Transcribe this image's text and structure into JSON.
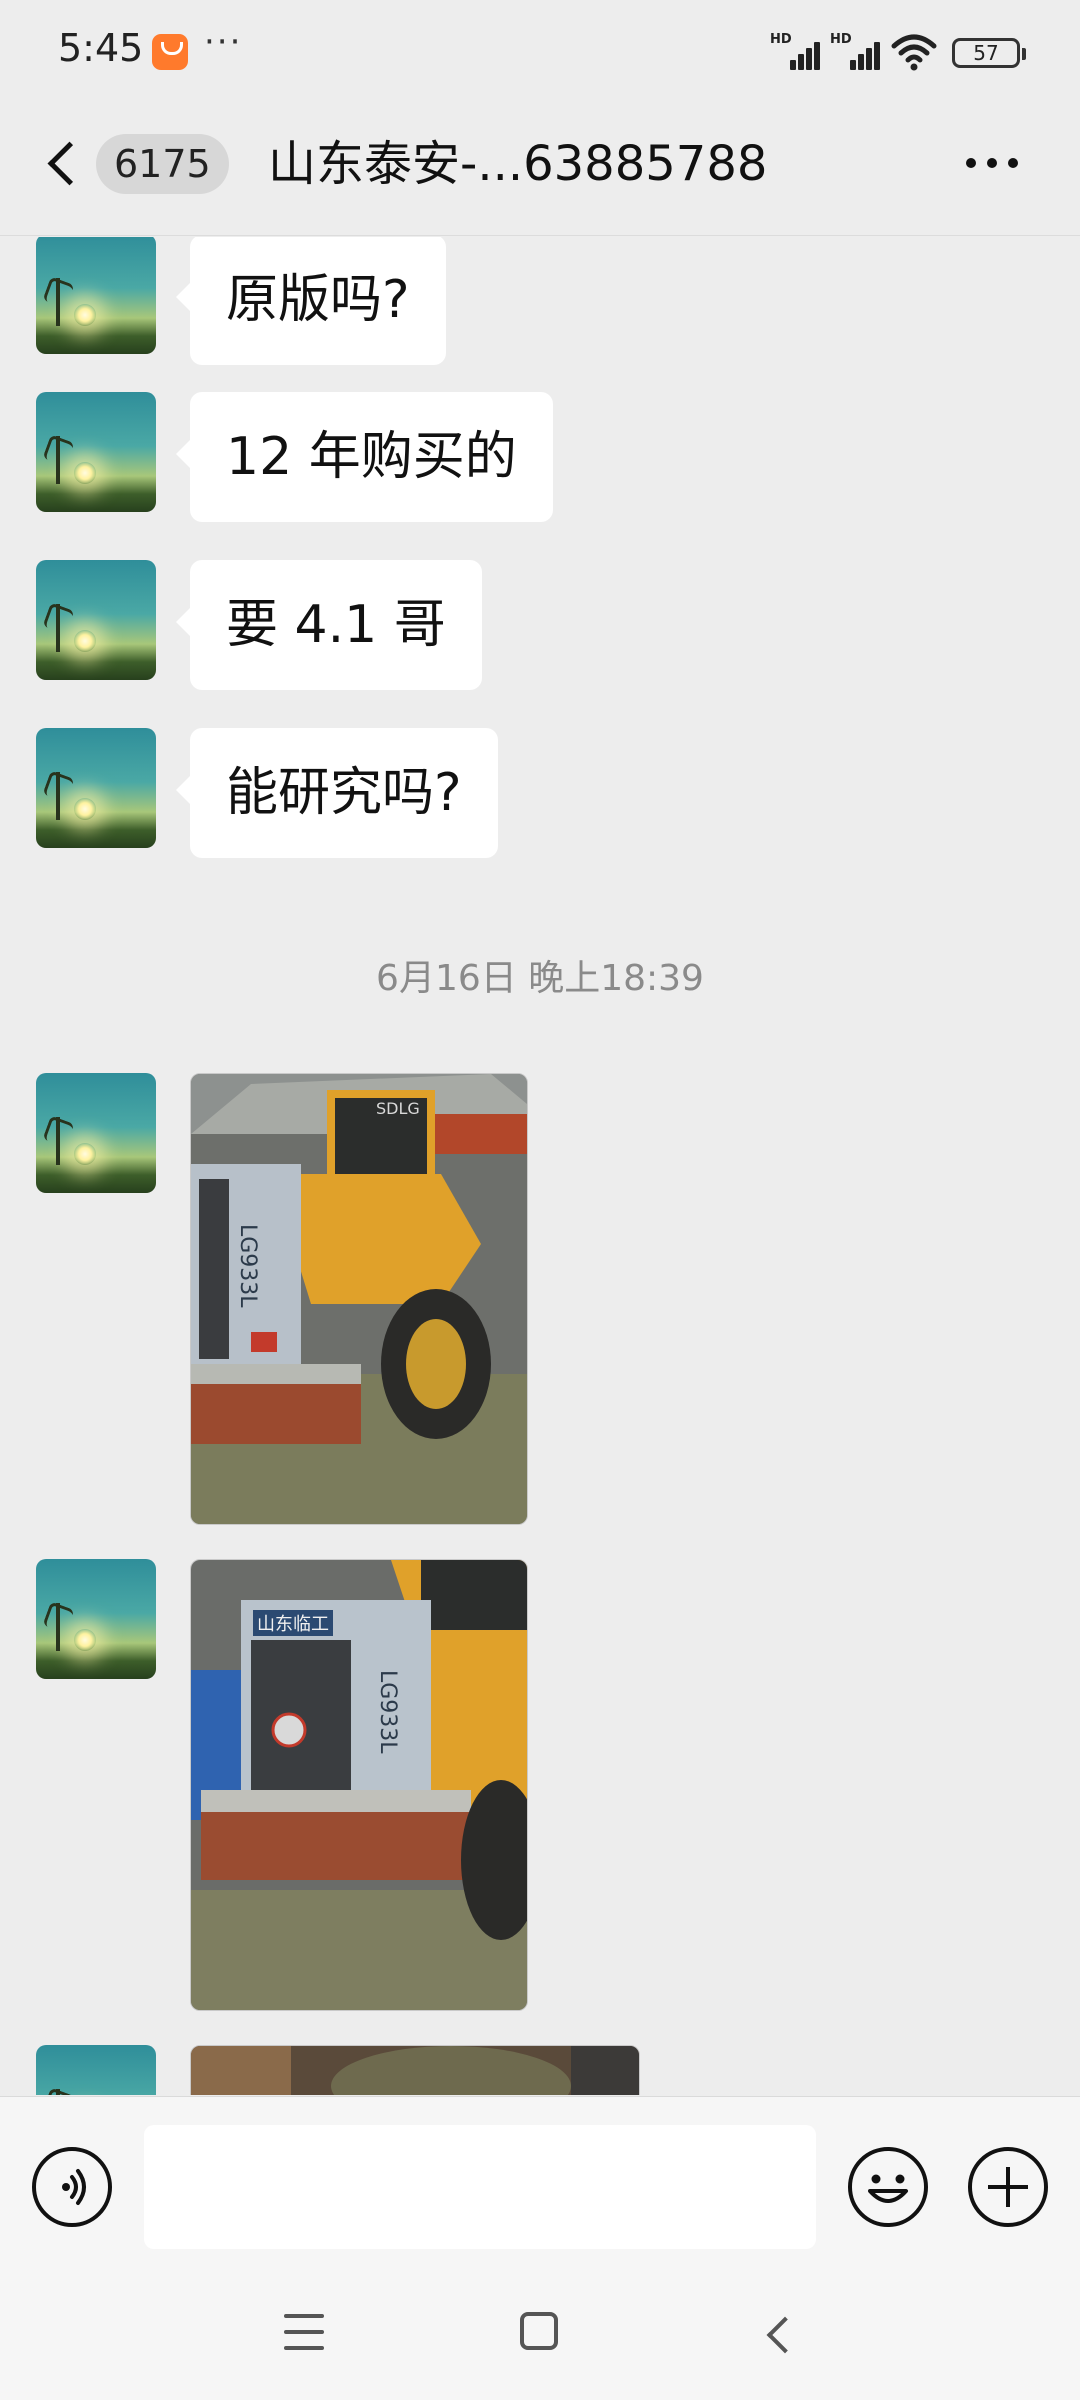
{
  "status_bar": {
    "time": "5:45",
    "app_icon": "taobao-notification-icon",
    "more_indicator": "···",
    "signal_label": "HD",
    "battery": "57"
  },
  "header": {
    "back_icon": "chevron-left-icon",
    "unread_count": "6175",
    "title": "山东泰安-...63885788",
    "more_icon": "more-dots-icon"
  },
  "messages": [
    {
      "type": "text",
      "text": "原版吗?"
    },
    {
      "type": "text",
      "text": "12 年购买的"
    },
    {
      "type": "text",
      "text": "要 4.1 哥"
    },
    {
      "type": "text",
      "text": "能研究吗?"
    }
  ],
  "timestamp": "6月16日 晚上18:39",
  "images": [
    {
      "description_icon": "photo-loader-rear",
      "model_text": "LG933L",
      "brand_text": "SDLG"
    },
    {
      "description_icon": "photo-loader-grille",
      "model_text": "LG933L",
      "brand_text": "山东临工"
    },
    {
      "description_icon": "photo-partial"
    }
  ],
  "input_bar": {
    "voice_icon": "voice-icon",
    "input_value": "",
    "emoji_icon": "emoji-icon",
    "plus_icon": "plus-icon"
  },
  "colors": {
    "background": "#ededed",
    "bubble": "#ffffff",
    "loader_yellow": "#e0a12a"
  }
}
